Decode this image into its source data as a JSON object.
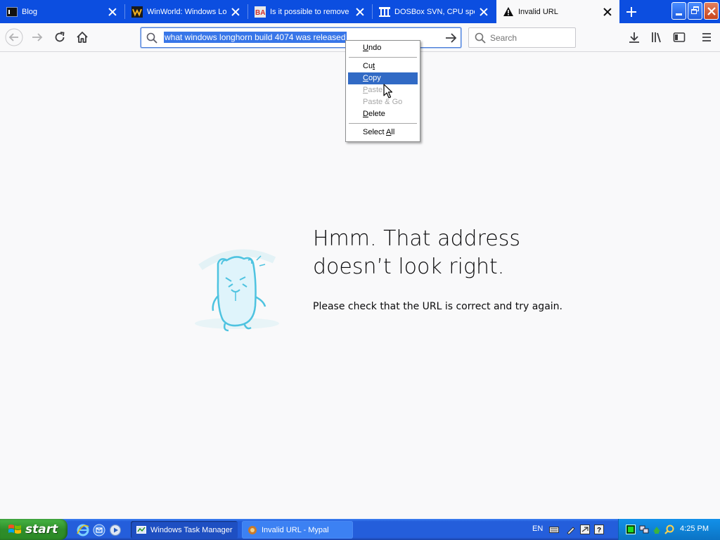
{
  "tabs": [
    {
      "title": "Blog",
      "active": false,
      "icon": "terminal-icon"
    },
    {
      "title": "WinWorld: Windows Lon",
      "active": false,
      "icon": "winworld-icon"
    },
    {
      "title": "Is it possible to remove",
      "active": false,
      "icon": "betaarchive-icon"
    },
    {
      "title": "DOSBox SVN, CPU spee",
      "active": false,
      "icon": "columns-icon"
    },
    {
      "title": "Invalid URL",
      "active": true,
      "icon": "warning-icon"
    }
  ],
  "urlbar": {
    "value": "what windows longhorn build 4074 was released"
  },
  "searchbar": {
    "placeholder": "Search"
  },
  "context_menu": {
    "items": [
      {
        "label": "Undo",
        "accel": "U",
        "state": "enabled"
      },
      {
        "label": "Cut",
        "accel": "t",
        "state": "enabled"
      },
      {
        "label": "Copy",
        "accel": "C",
        "state": "highlighted"
      },
      {
        "label": "Paste",
        "accel": "P",
        "state": "disabled"
      },
      {
        "label": "Paste & Go",
        "accel": "",
        "state": "disabled"
      },
      {
        "label": "Delete",
        "accel": "D",
        "state": "enabled"
      },
      {
        "label": "Select All",
        "accel": "A",
        "state": "enabled"
      }
    ]
  },
  "error_page": {
    "title_line1": "Hmm. That address",
    "title_line2": "doesn’t look right.",
    "description": "Please check that the URL is correct and try again."
  },
  "taskbar": {
    "start_label": "start",
    "tasks": [
      {
        "label": "Windows Task Manager",
        "active": true
      },
      {
        "label": "Invalid URL - Mypal",
        "active": false
      }
    ],
    "language": "EN",
    "clock": "4:25 PM"
  },
  "colors": {
    "tabstrip": "#0c4ee0",
    "selection": "#3876e8",
    "menu_highlight": "#316ac5",
    "taskbar": "#245edb",
    "start_button": "#2f8d2a"
  }
}
